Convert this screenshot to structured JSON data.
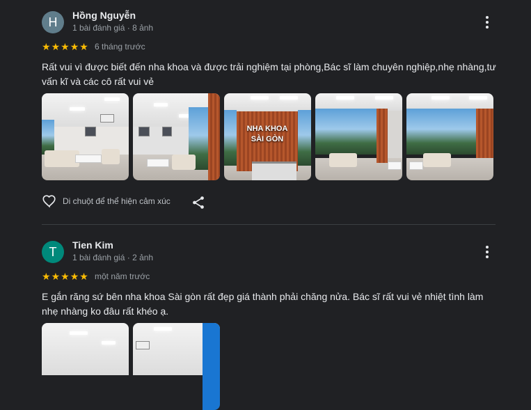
{
  "reviews": [
    {
      "avatar_letter": "H",
      "avatar_color": "#607d8b",
      "name": "Hồng Nguyễn",
      "meta": "1 bài đánh giá · 8 ảnh",
      "stars": [
        "★",
        "★",
        "★",
        "★",
        "★"
      ],
      "rating": 5,
      "time": "6 tháng trước",
      "text": "Rất vui vì được biết đến nha khoa và được trải nghiệm tại phòng,Bác sĩ làm chuyên nghiệp,nhẹ nhàng,tư vấn kĩ và các cô rất vui vẻ",
      "photo_sign": "NHA KHOA SÀI GÒN",
      "react_label": "Di chuột để thể hiện cảm xúc"
    },
    {
      "avatar_letter": "T",
      "avatar_color": "#00897b",
      "name": "Tien Kim",
      "meta": "1 bài đánh giá · 2 ảnh",
      "stars": [
        "★",
        "★",
        "★",
        "★",
        "★"
      ],
      "rating": 5,
      "time": "một năm trước",
      "text": "E gắn răng sứ bên nha khoa Sài gòn rất đẹp giá thành phải chăng nửa. Bác sĩ rất vui vẻ nhiệt tình làm nhẹ nhàng ko đâu rất khéo ạ."
    }
  ],
  "colors": {
    "star": "#fbbc04",
    "background": "#202124",
    "text": "#e8eaed",
    "muted": "#9aa0a6"
  },
  "icons": [
    "heart-outline-icon",
    "share-icon",
    "more-vert-icon",
    "star-icon"
  ]
}
